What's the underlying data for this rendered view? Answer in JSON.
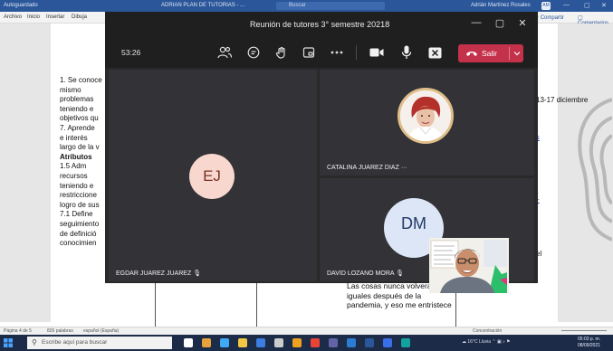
{
  "word": {
    "title_left": "Autoguardado",
    "title_doc": "ADRIAN PLAN DE TUTORIAS - ...",
    "search_placeholder": "Buscar",
    "user_name": "Adrián Martínez Rosales",
    "user_initials": "AM",
    "menu_items": [
      "Archivo",
      "Inicio",
      "Insertar",
      "Dibuja"
    ],
    "share_label": "Compartir",
    "comments_label": "Comentarios",
    "left_column_lines": [
      "1. Se conoce",
      "mismo",
      "problemas",
      "teniendo e",
      "objetivos qu",
      "7. Aprende",
      "e interés",
      "largo de la v",
      "Atributos",
      "1.5 Adm",
      "recursos",
      "teniendo e",
      "restriccione",
      "logro de sus",
      "7.1 Define",
      "seguimiento",
      "de definició",
      "conocimien"
    ],
    "right_date": "13-17 diciembre",
    "right_links_top": [
      "y",
      "ec",
      "m",
      "ras"
    ],
    "right_links_mid": [
      "tru",
      "es-",
      "o-"
    ],
    "right_el": "el",
    "bottom_text": "Las cosas nunca volverán a ser iguales después de la pandemia, y eso me entristece",
    "status_left": "Página 4 de 5",
    "status_words": "826 palabras",
    "status_lang": "español (España)",
    "status_focus": "Concentración"
  },
  "taskbar": {
    "search_placeholder": "Escribe aquí para buscar",
    "weather": "16°C Lluvia",
    "time": "05:03 p. m.",
    "date": "08/09/2021",
    "app_icon_colors": [
      "#ffffff",
      "#e8a23c",
      "#3fa9f5",
      "#f2c744",
      "#3b7de0",
      "#cccccc",
      "#f0a020",
      "#ea4335",
      "#6264a7",
      "#2b7cd3",
      "#2b579a",
      "#3a6ee8",
      "#12a3a0"
    ]
  },
  "teams": {
    "meeting_title": "Reunión de tutores 3° semestre 20218",
    "timer": "53:26",
    "leave_label": "Salir",
    "participants": [
      {
        "initials": "EJ",
        "name": "EGDAR JUAREZ JUAREZ"
      },
      {
        "name": "CATALINA JUAREZ DIAZ",
        "more": "···"
      },
      {
        "initials": "DM",
        "name": "DAVID LOZANO MORA"
      }
    ],
    "colors": {
      "leave_red": "#c4314b",
      "ej_avatar_bg": "#f8d7cf",
      "dm_avatar_bg": "#dde6f6",
      "ring_gold": "#e0be8a"
    }
  }
}
